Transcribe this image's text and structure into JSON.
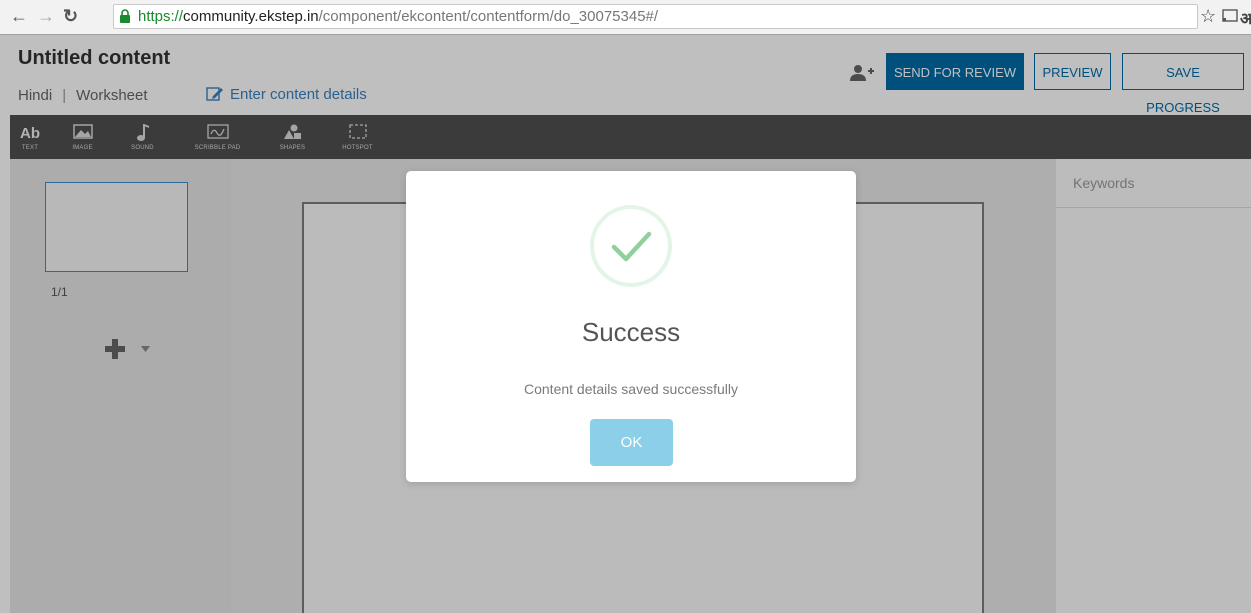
{
  "browser": {
    "url_scheme": "https://",
    "url_host": "community.ekstep.in",
    "url_path": "/component/ekcontent/contentform/do_30075345#/",
    "back_icon": "arrow-left-icon",
    "forward_icon": "arrow-right-icon",
    "reload_icon": "reload-icon",
    "bookmark_icon": "star-icon",
    "cast_icon": "cast-icon",
    "translate_label": "अ"
  },
  "header": {
    "title": "Untitled content",
    "language": "Hindi",
    "separator": "|",
    "type": "Worksheet",
    "details_link": "Enter content details",
    "collaborator_icon": "add-user-icon"
  },
  "buttons": {
    "send_for_review": "SEND FOR REVIEW",
    "preview": "PREVIEW",
    "save_progress": "SAVE PROGRESS"
  },
  "toolbar": {
    "items": [
      {
        "icon_text": "Ab",
        "label": "TEXT",
        "icon": "text-icon"
      },
      {
        "label": "IMAGE",
        "icon": "image-icon"
      },
      {
        "label": "SOUND",
        "icon": "music-note-icon"
      },
      {
        "label": "SCRIBBLE PAD",
        "icon": "scribble-icon"
      },
      {
        "label": "SHAPES",
        "icon": "shapes-icon"
      },
      {
        "label": "HOTSPOT",
        "icon": "hotspot-icon"
      }
    ]
  },
  "stage_panel": {
    "page_label": "1/1"
  },
  "properties_panel": {
    "keywords_label": "Keywords"
  },
  "modal": {
    "title": "Success",
    "message": "Content details saved successfully",
    "ok_label": "OK",
    "icon": "check-icon",
    "accent_color": "#8ccfe8",
    "check_color": "#8fd19e"
  },
  "colors": {
    "primary": "#006ba8",
    "toolbar_bg": "#4f4f4f",
    "link": "#3a82c0"
  }
}
